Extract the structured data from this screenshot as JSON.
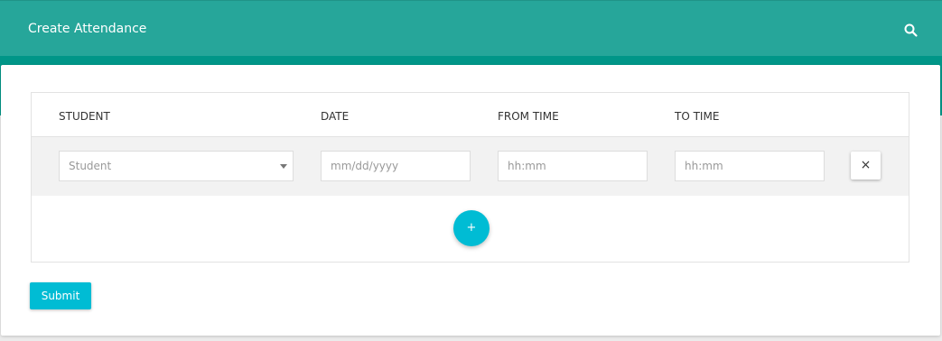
{
  "header": {
    "title": "Create Attendance",
    "search_icon": "search-icon"
  },
  "table": {
    "columns": [
      "STUDENT",
      "DATE",
      "FROM TIME",
      "TO TIME"
    ],
    "rows": [
      {
        "student": {
          "value": "",
          "placeholder": "Student"
        },
        "date": {
          "value": "",
          "placeholder": "mm/dd/yyyy"
        },
        "from_time": {
          "value": "",
          "placeholder": "hh:mm"
        },
        "to_time": {
          "value": "",
          "placeholder": "hh:mm"
        },
        "remove_label": "×"
      }
    ],
    "add_label": "+"
  },
  "form": {
    "submit_label": "Submit"
  },
  "colors": {
    "header_bg": "#26a69a",
    "band_bg": "#009688",
    "accent": "#00bcd4"
  }
}
